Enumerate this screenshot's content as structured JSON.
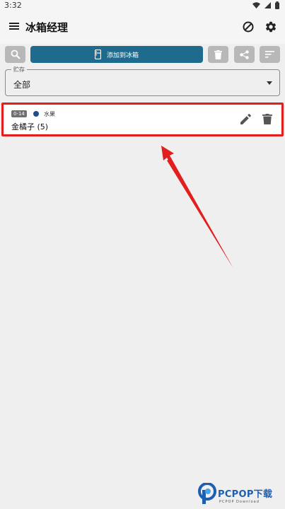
{
  "status_bar": {
    "time": "3:32"
  },
  "app_bar": {
    "title": "冰箱经理",
    "icons": [
      "menu-icon",
      "block-icon",
      "gear-icon"
    ]
  },
  "toolbar": {
    "add_label": "添加到冰箱",
    "icons": [
      "search-icon",
      "fridge-icon",
      "trash-icon",
      "share-icon",
      "sort-icon"
    ]
  },
  "storage_select": {
    "label": "贮存",
    "value": "全部"
  },
  "items": [
    {
      "expiry": "0-14",
      "category": "水果",
      "category_color": "#1e4f8a",
      "name": "金橘子 (5)"
    }
  ],
  "colors": {
    "accent": "#1f6b8e",
    "highlight": "#e21f1f"
  },
  "watermark": {
    "brand": "PCPOP下载",
    "sub": "PCPOP Download"
  }
}
